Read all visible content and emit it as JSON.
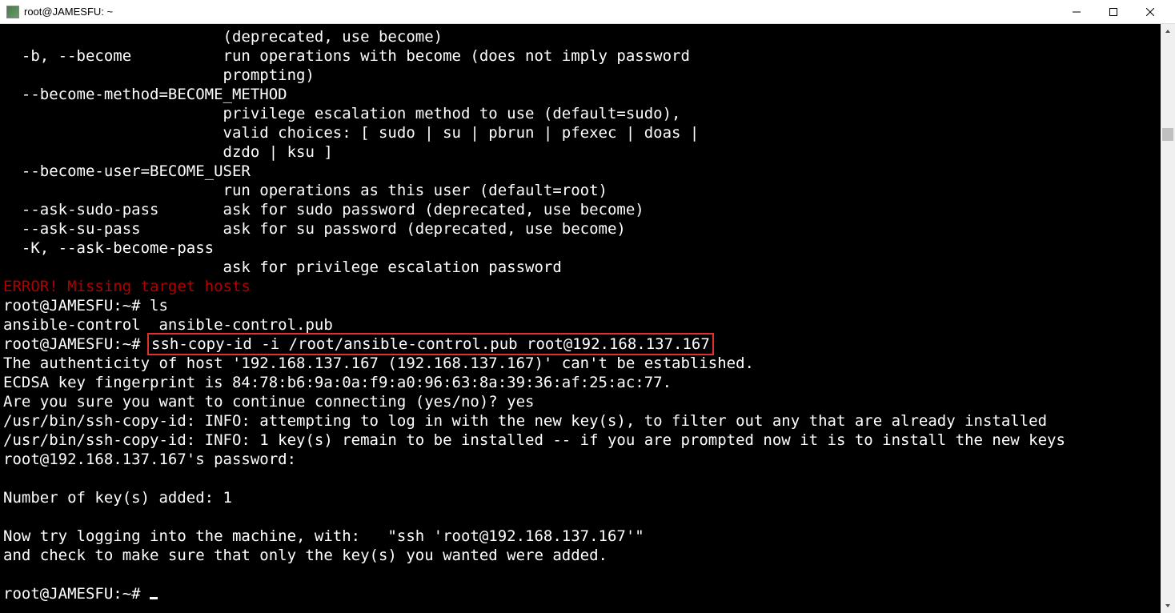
{
  "window": {
    "title": "root@JAMESFU: ~"
  },
  "terminal": {
    "lines": {
      "l0": "                        (deprecated, use become)",
      "l1": "  -b, --become          run operations with become (does not imply password",
      "l2": "                        prompting)",
      "l3": "  --become-method=BECOME_METHOD",
      "l4": "                        privilege escalation method to use (default=sudo),",
      "l5": "                        valid choices: [ sudo | su | pbrun | pfexec | doas |",
      "l6": "                        dzdo | ksu ]",
      "l7": "  --become-user=BECOME_USER",
      "l8": "                        run operations as this user (default=root)",
      "l9": "  --ask-sudo-pass       ask for sudo password (deprecated, use become)",
      "l10": "  --ask-su-pass         ask for su password (deprecated, use become)",
      "l11": "  -K, --ask-become-pass",
      "l12": "                        ask for privilege escalation password",
      "l13_err": "ERROR! Missing target hosts",
      "l14_prompt": "root@JAMESFU:~# ",
      "l14_cmd": "ls",
      "l15": "ansible-control  ansible-control.pub",
      "l16_prompt": "root@JAMESFU:~# ",
      "l16_cmd_highlighted": "ssh-copy-id -i /root/ansible-control.pub root@192.168.137.167",
      "l17": "The authenticity of host '192.168.137.167 (192.168.137.167)' can't be established.",
      "l18": "ECDSA key fingerprint is 84:78:b6:9a:0a:f9:a0:96:63:8a:39:36:af:25:ac:77.",
      "l19": "Are you sure you want to continue connecting (yes/no)? yes",
      "l20": "/usr/bin/ssh-copy-id: INFO: attempting to log in with the new key(s), to filter out any that are already installed",
      "l21": "/usr/bin/ssh-copy-id: INFO: 1 key(s) remain to be installed -- if you are prompted now it is to install the new keys",
      "l22": "root@192.168.137.167's password:",
      "l23": "",
      "l24": "Number of key(s) added: 1",
      "l25": "",
      "l26": "Now try logging into the machine, with:   \"ssh 'root@192.168.137.167'\"",
      "l27": "and check to make sure that only the key(s) you wanted were added.",
      "l28": "",
      "l29_prompt": "root@JAMESFU:~# "
    }
  }
}
